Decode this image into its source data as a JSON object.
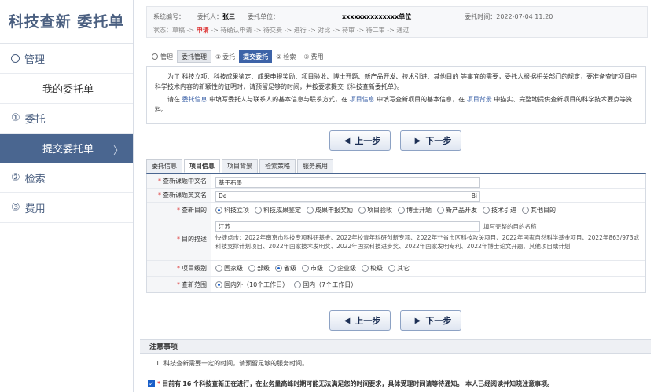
{
  "sidebar": {
    "title": "科技查新 委托单",
    "items": [
      {
        "icon": "○",
        "label": "管理"
      },
      {
        "label": "我的委托单"
      },
      {
        "icon": "①",
        "label": "委托"
      },
      {
        "label": "提交委托单"
      },
      {
        "icon": "②",
        "label": "检索"
      },
      {
        "icon": "③",
        "label": "费用"
      }
    ],
    "active_chevron": "〉"
  },
  "info": {
    "sys_no_label": "系统编号：",
    "sys_no_value": "",
    "client_label": "委托人：",
    "client_value": "张三",
    "unit_label": "委托单位：",
    "unit_value": "xxxxxxxxxxxxxx单位",
    "time_label": "委托时间：",
    "time_value": "2022-07-04 11:20",
    "status_label": "状态：",
    "status_before": "草稿 -> ",
    "status_current": "申请",
    "status_after": " -> 待确认申请 -> 待交费 -> 进行 -> 对比 -> 待审 -> 待二审 -> 通过"
  },
  "toptabs": [
    {
      "icon": "○",
      "label": "管理"
    },
    {
      "label": "委托管理"
    },
    {
      "icon": "①",
      "label": "委托"
    },
    {
      "label": "提交委托"
    },
    {
      "icon": "②",
      "label": "检索"
    },
    {
      "icon": "③",
      "label": "费用"
    }
  ],
  "intro": {
    "p1": "为了 科技立项、科技成果鉴定、成果申报奖励、项目验收、博士开题、新产品开发、技术引进、其他目的 等事宜的需要，委托人根据相关部门的规定，要准备查证项目中科学技术内容的新颖性的证明时，请预留足够的时间，并按要求提交《科技查新委托单》。",
    "p2_a": "请在 ",
    "p2_link1": "委托信息",
    "p2_b": " 中填写委托人与联系人的基本信息与联系方式，在 ",
    "p2_link2": "项目信息",
    "p2_c": " 中填写查新项目的基本信息，在 ",
    "p2_link3": "项目背景",
    "p2_d": " 中描实、完整地提供查新项目的科学技术要点等资料。"
  },
  "buttons": {
    "prev": "上一步",
    "next": "下一步",
    "prev_arrow": "◀",
    "next_arrow": "▶"
  },
  "subtabs": [
    "委托信息",
    "项目信息",
    "项目背景",
    "检索策略",
    "服务费用"
  ],
  "form": {
    "cn_title_label": "查新课题中文名",
    "cn_title_value": "基于石墨",
    "en_title_label": "查新课题英文名",
    "en_title_value": "De",
    "en_title_tail": "Bi",
    "purpose_label": "查新目的",
    "purpose_options": [
      "科技立项",
      "科技成果鉴定",
      "成果申报奖励",
      "项目验收",
      "博士开题",
      "新产品开发",
      "技术引进",
      "其他目的"
    ],
    "purpose_selected": 0,
    "desc_label": "目的描述",
    "desc_value": "江苏",
    "desc_hint": "填写完整的目的名称",
    "desc_quick": "快捷点击：2022年南京市科技专项科研基金、2022年校青年科研创新专项、2022年**省市区科技攻关项目、2022年国家自然科学基金项目、2022年863/973或科技支撑计划项目、2022年国家技术发明奖、2022年国家科技进步奖、2022年国家发明专利、2022年博士论文开题、其他项目或计划",
    "level_label": "项目级别",
    "level_options": [
      "国家级",
      "部级",
      "省级",
      "市级",
      "企业级",
      "校级",
      "其它"
    ],
    "level_selected": 2,
    "scope_label": "查新范围",
    "scope_options": [
      "国内外（10个工作日）",
      "国内（7个工作日）"
    ],
    "scope_selected": 0
  },
  "notice": {
    "title": "注意事项",
    "item1": "1. 科技查新需要一定的时间，请预留足够的服务时间。",
    "agree_a": "目前有 ",
    "agree_count": "16",
    "agree_b": " 个科技查新正在进行，在业务量高峰时期可能无法满足您的时间要求，具体受理时间请等待通知。 本人已经阅读并知晓注意事项。"
  }
}
